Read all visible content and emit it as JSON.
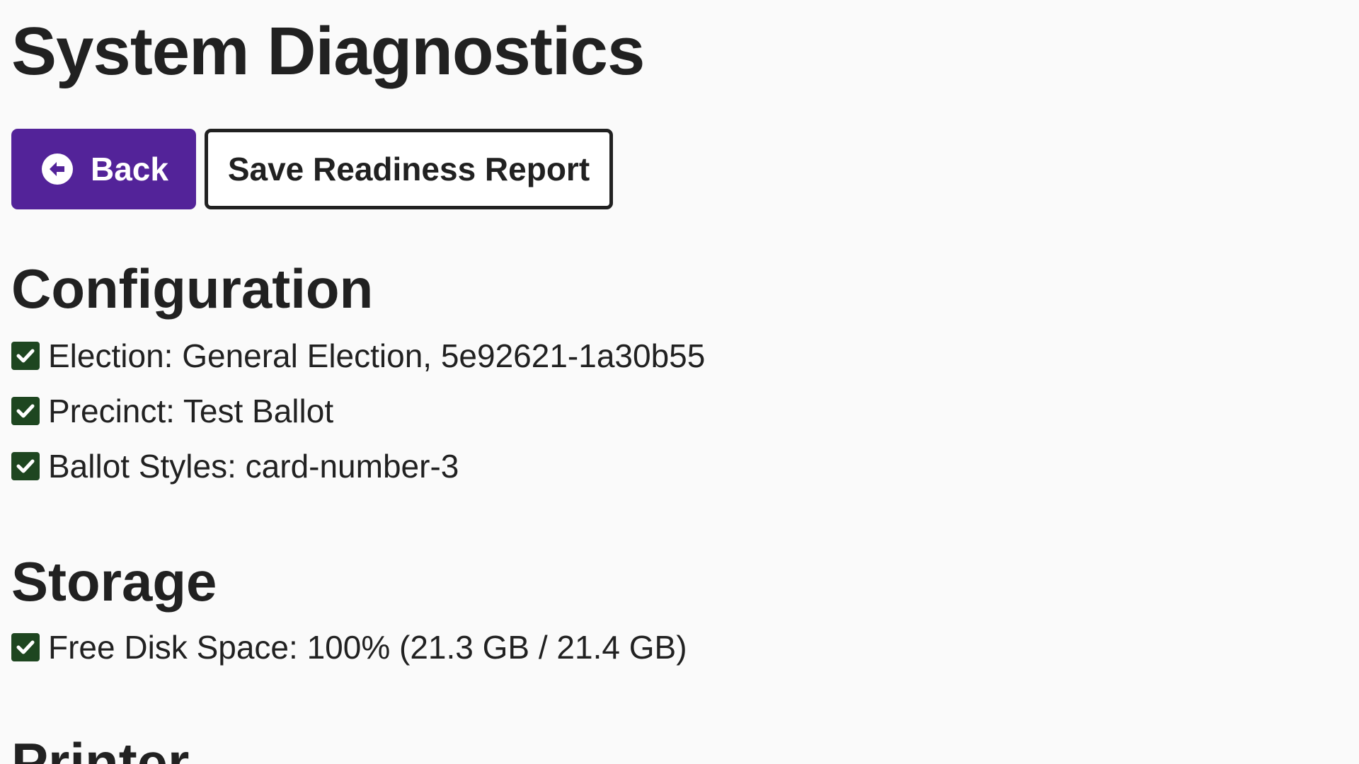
{
  "page": {
    "title": "System Diagnostics"
  },
  "toolbar": {
    "back_label": "Back",
    "back_icon": "circle-arrow-left-icon",
    "save_label": "Save Readiness Report"
  },
  "configuration": {
    "heading": "Configuration",
    "items": [
      {
        "status": "ok",
        "icon": "checkbox-checked-icon",
        "text": "Election: General Election, 5e92621-1a30b55"
      },
      {
        "status": "ok",
        "icon": "checkbox-checked-icon",
        "text": "Precinct: Test Ballot"
      },
      {
        "status": "ok",
        "icon": "checkbox-checked-icon",
        "text": "Ballot Styles: card-number-3"
      }
    ]
  },
  "storage": {
    "heading": "Storage",
    "items": [
      {
        "status": "ok",
        "icon": "checkbox-checked-icon",
        "text": "Free Disk Space: 100% (21.3 GB / 21.4 GB)"
      }
    ]
  },
  "printer": {
    "heading": "Printer"
  },
  "colors": {
    "primary": "#532399",
    "success": "#1e4620",
    "text": "#212121",
    "background": "#fafafa"
  }
}
